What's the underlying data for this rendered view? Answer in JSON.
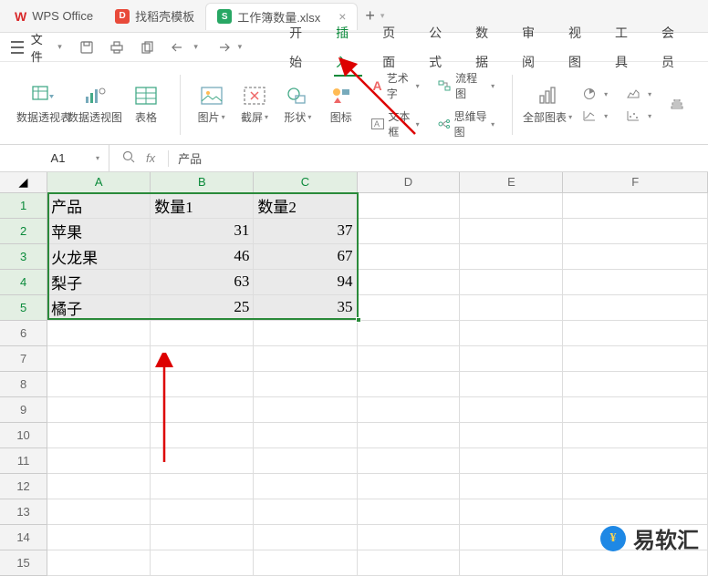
{
  "titlebar": {
    "app_name": "WPS Office",
    "tab1": "找稻壳模板",
    "tab2": "工作簿数量.xlsx"
  },
  "menubar": {
    "file": "文件",
    "tabs": [
      "开始",
      "插入",
      "页面",
      "公式",
      "数据",
      "审阅",
      "视图",
      "工具",
      "会员"
    ],
    "active_index": 1
  },
  "ribbon": {
    "pivot_table": "数据透视表",
    "pivot_chart": "数据透视图",
    "table": "表格",
    "picture": "图片",
    "screenshot": "截屏",
    "shapes": "形状",
    "icons": "图标",
    "wordart": "艺术字",
    "textbox": "文本框",
    "flowchart": "流程图",
    "mindmap": "思维导图",
    "all_charts": "全部图表"
  },
  "namebox": "A1",
  "formula_value": "产品",
  "columns": [
    "A",
    "B",
    "C",
    "D",
    "E",
    "F"
  ],
  "rows": [
    1,
    2,
    3,
    4,
    5,
    6,
    7,
    8,
    9,
    10,
    11,
    12,
    13,
    14,
    15
  ],
  "chart_data": {
    "type": "table",
    "headers": [
      "产品",
      "数量1",
      "数量2"
    ],
    "data": [
      {
        "产品": "苹果",
        "数量1": 31,
        "数量2": 37
      },
      {
        "产品": "火龙果",
        "数量1": 46,
        "数量2": 67
      },
      {
        "产品": "梨子",
        "数量1": 63,
        "数量2": 94
      },
      {
        "产品": "橘子",
        "数量1": 25,
        "数量2": 35
      }
    ]
  },
  "watermark": "易软汇"
}
